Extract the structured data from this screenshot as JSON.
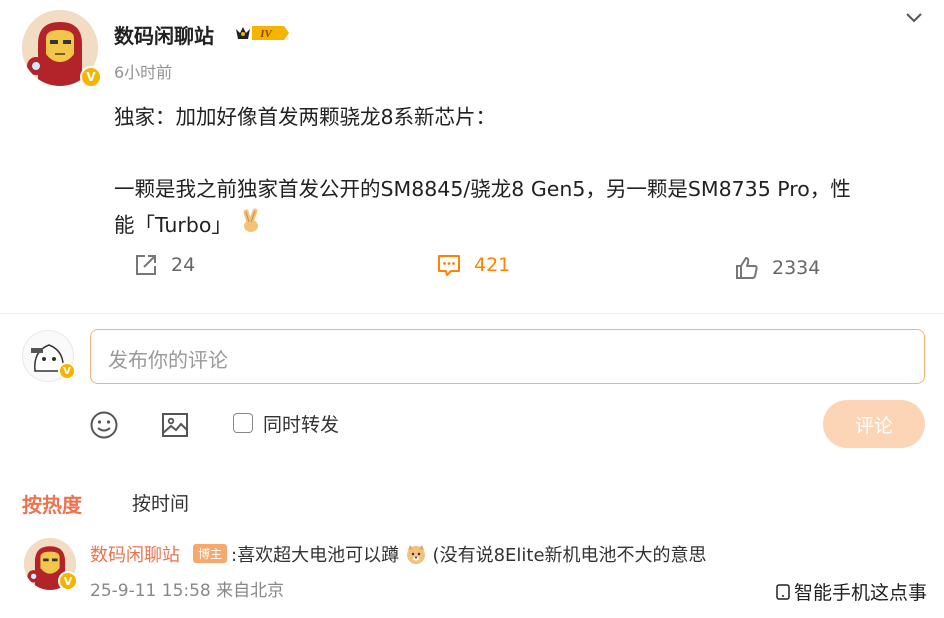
{
  "post": {
    "author": "数码闲聊站",
    "level": "IV",
    "time": "6小时前",
    "content_line1": "独家：加加好像首发两颗骁龙8系新芯片：",
    "content_line2": "一颗是我之前独家首发公开的SM8845/骁龙8 Gen5，另一颗是SM8735 Pro，性",
    "content_line3": "能「Turbo」",
    "content_emoji": "victory-hand",
    "reposts": "24",
    "comments": "421",
    "likes": "2334"
  },
  "composer": {
    "placeholder": "发布你的评论",
    "repost_label": "同时转发",
    "submit_label": "评论"
  },
  "sort": {
    "hot": "按热度",
    "time": "按时间"
  },
  "comment": {
    "author": "数码闲聊站",
    "badge": "博主",
    "text": ":喜欢超大电池可以蹲",
    "emoji": "doge",
    "text_after": " (没有说8Elite新机电池不大的意思",
    "date": "25-9-11 15:58",
    "source": "来自北京"
  },
  "watermark": "智能手机这点事",
  "colors": {
    "accent_orange": "#ff8200",
    "author_orange": "#eb7350",
    "verify_gold": "#f6b400",
    "submit_disabled": "#fbd5b6"
  }
}
